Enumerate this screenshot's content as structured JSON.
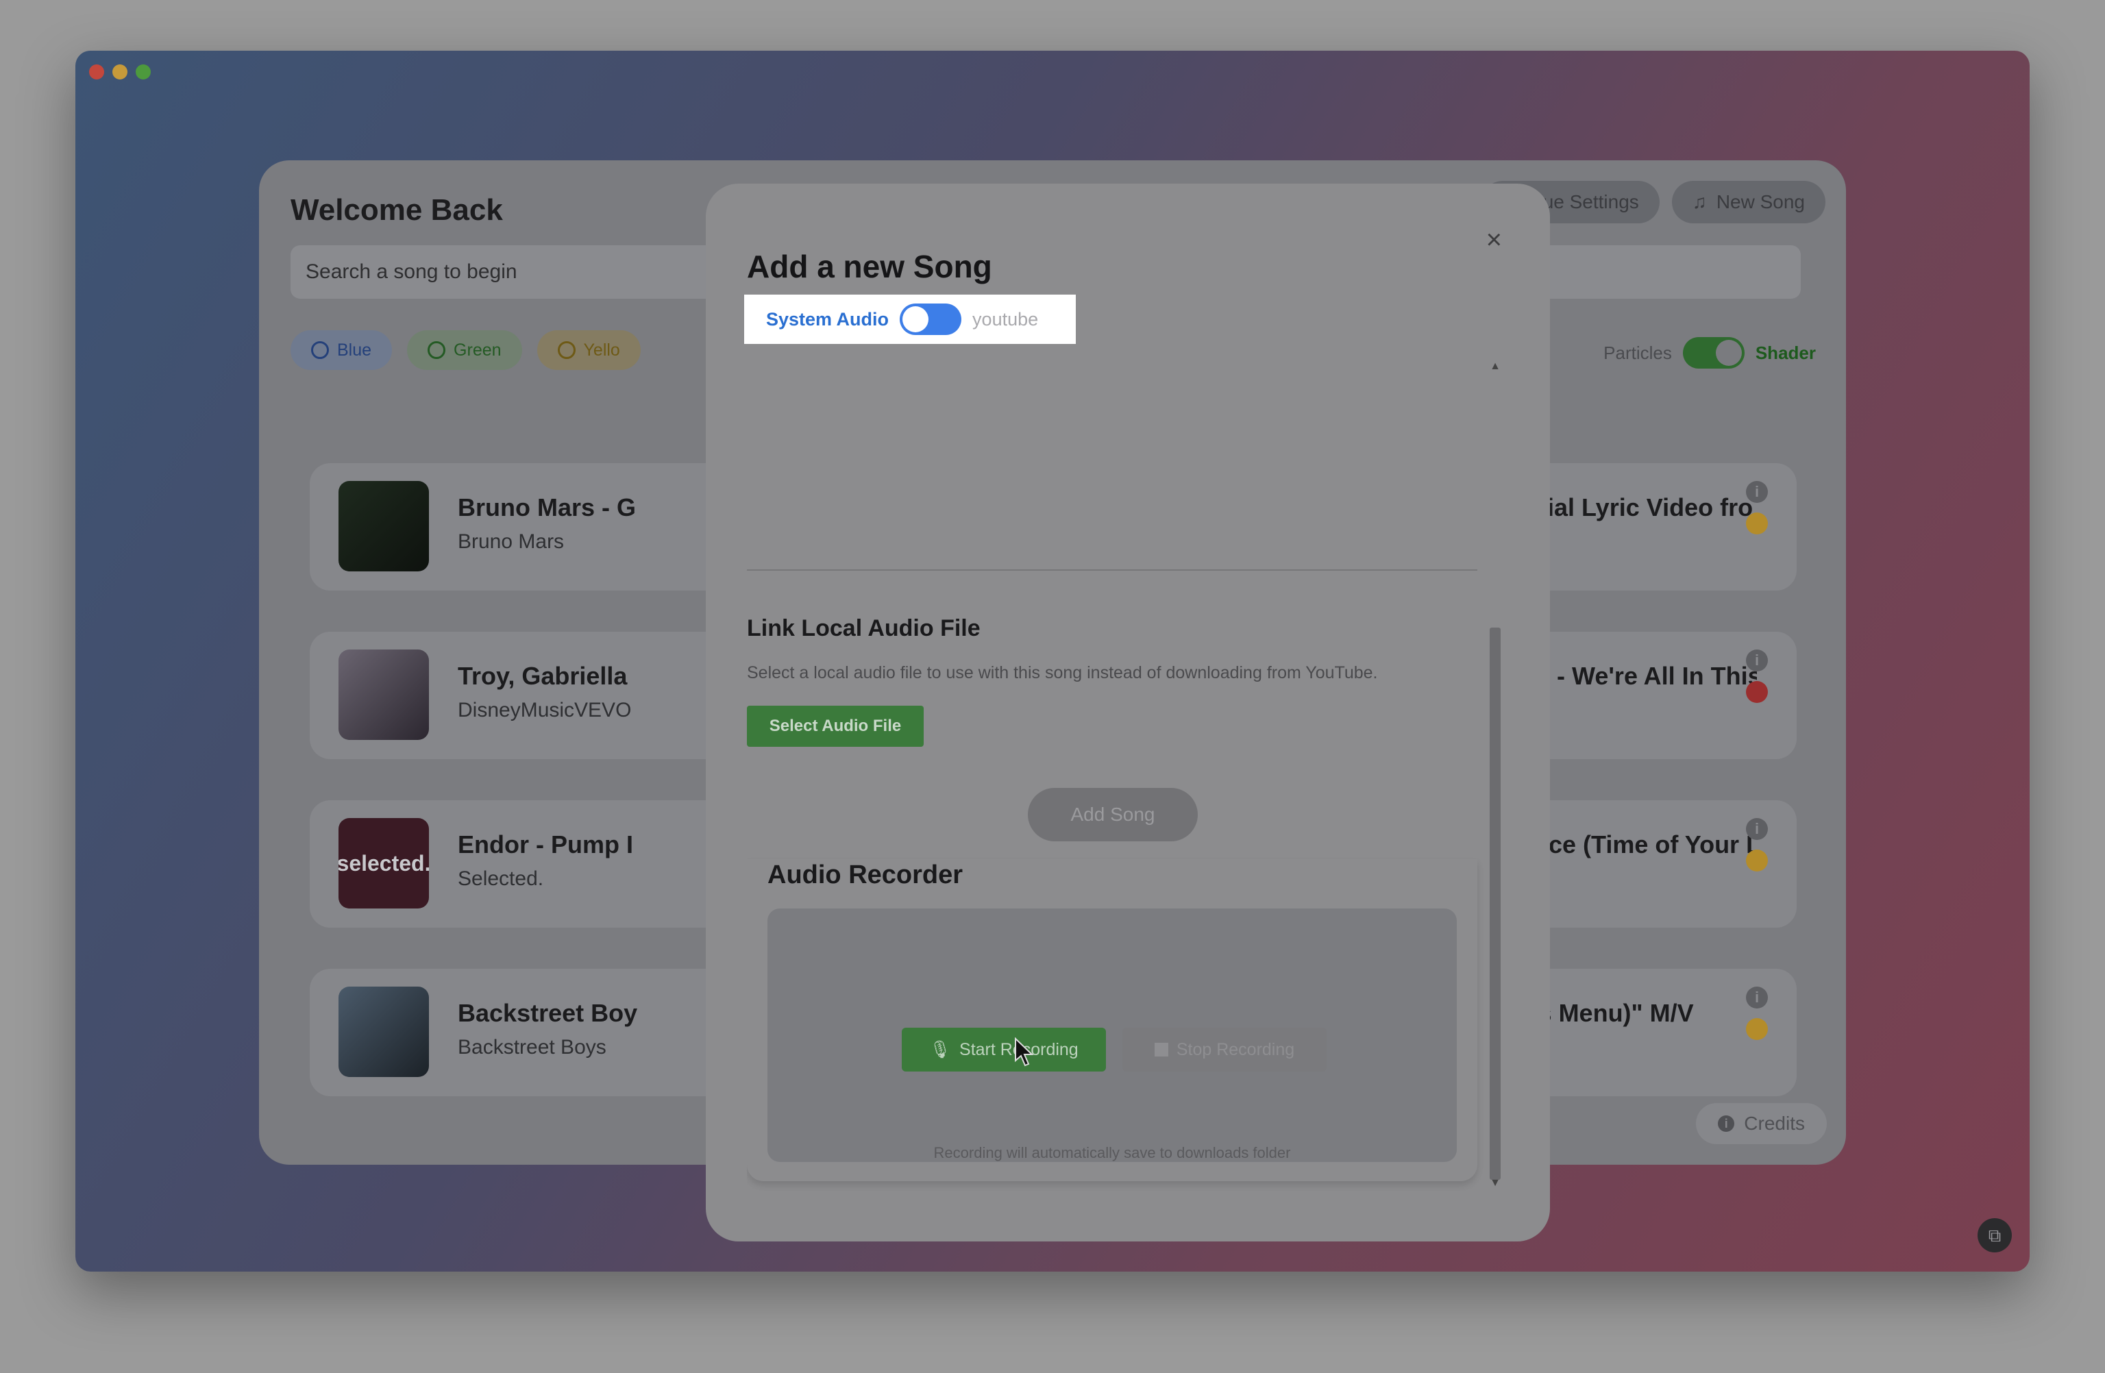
{
  "background": {
    "welcome_title": "Welcome Back",
    "search_placeholder": "Search a song to begin",
    "chips": [
      {
        "label": "Blue",
        "color": "#24407a"
      },
      {
        "label": "Green",
        "color": "#245a24"
      },
      {
        "label": "Yello",
        "color": "#6e5a16"
      }
    ],
    "toolbar": {
      "hue_settings_label": "Hue Settings",
      "new_song_label": "New Song"
    },
    "fx_toggle": {
      "off_label": "Particles",
      "on_label": "Shader"
    },
    "songs": [
      {
        "title": "Bruno Mars - G",
        "artist": "Bruno Mars",
        "tail": "(Official Lyric Video fro",
        "dot_color": "#b48c2a"
      },
      {
        "title": "Troy, Gabriella",
        "artist": "DisneyMusicVEVO",
        "tail": "l Cast - We're All In This",
        "dot_color": "#9a2e2e"
      },
      {
        "title": "Endor - Pump I",
        "artist": "Selected.",
        "tail": "iddance (Time of Your L",
        "dot_color": "#b48c2a",
        "thumb_text": "selected."
      },
      {
        "title": "Backstreet Boy",
        "artist": "Backstreet Boys",
        "tail": "God's Menu)\" M/V",
        "dot_color": "#b48c2a"
      }
    ],
    "credits_label": "Credits"
  },
  "modal": {
    "title": "Add a new Song",
    "close_glyph": "×",
    "source_toggle": {
      "on_label": "System Audio",
      "off_label": "youtube"
    },
    "local_file": {
      "title": "Link Local Audio File",
      "description": "Select a local audio file to use with this song instead of downloading from YouTube.",
      "select_button": "Select Audio File"
    },
    "add_song_button": "Add Song",
    "recorder": {
      "title": "Audio Recorder",
      "start_button": "Start Recording",
      "stop_button": "Stop Recording",
      "note": "Recording will automatically save to downloads folder"
    }
  },
  "icons": {
    "close": "close-icon",
    "gear": "gear-icon",
    "music": "music-note-icon",
    "mic": "microphone-icon",
    "stop": "stop-icon",
    "info": "info-icon"
  }
}
